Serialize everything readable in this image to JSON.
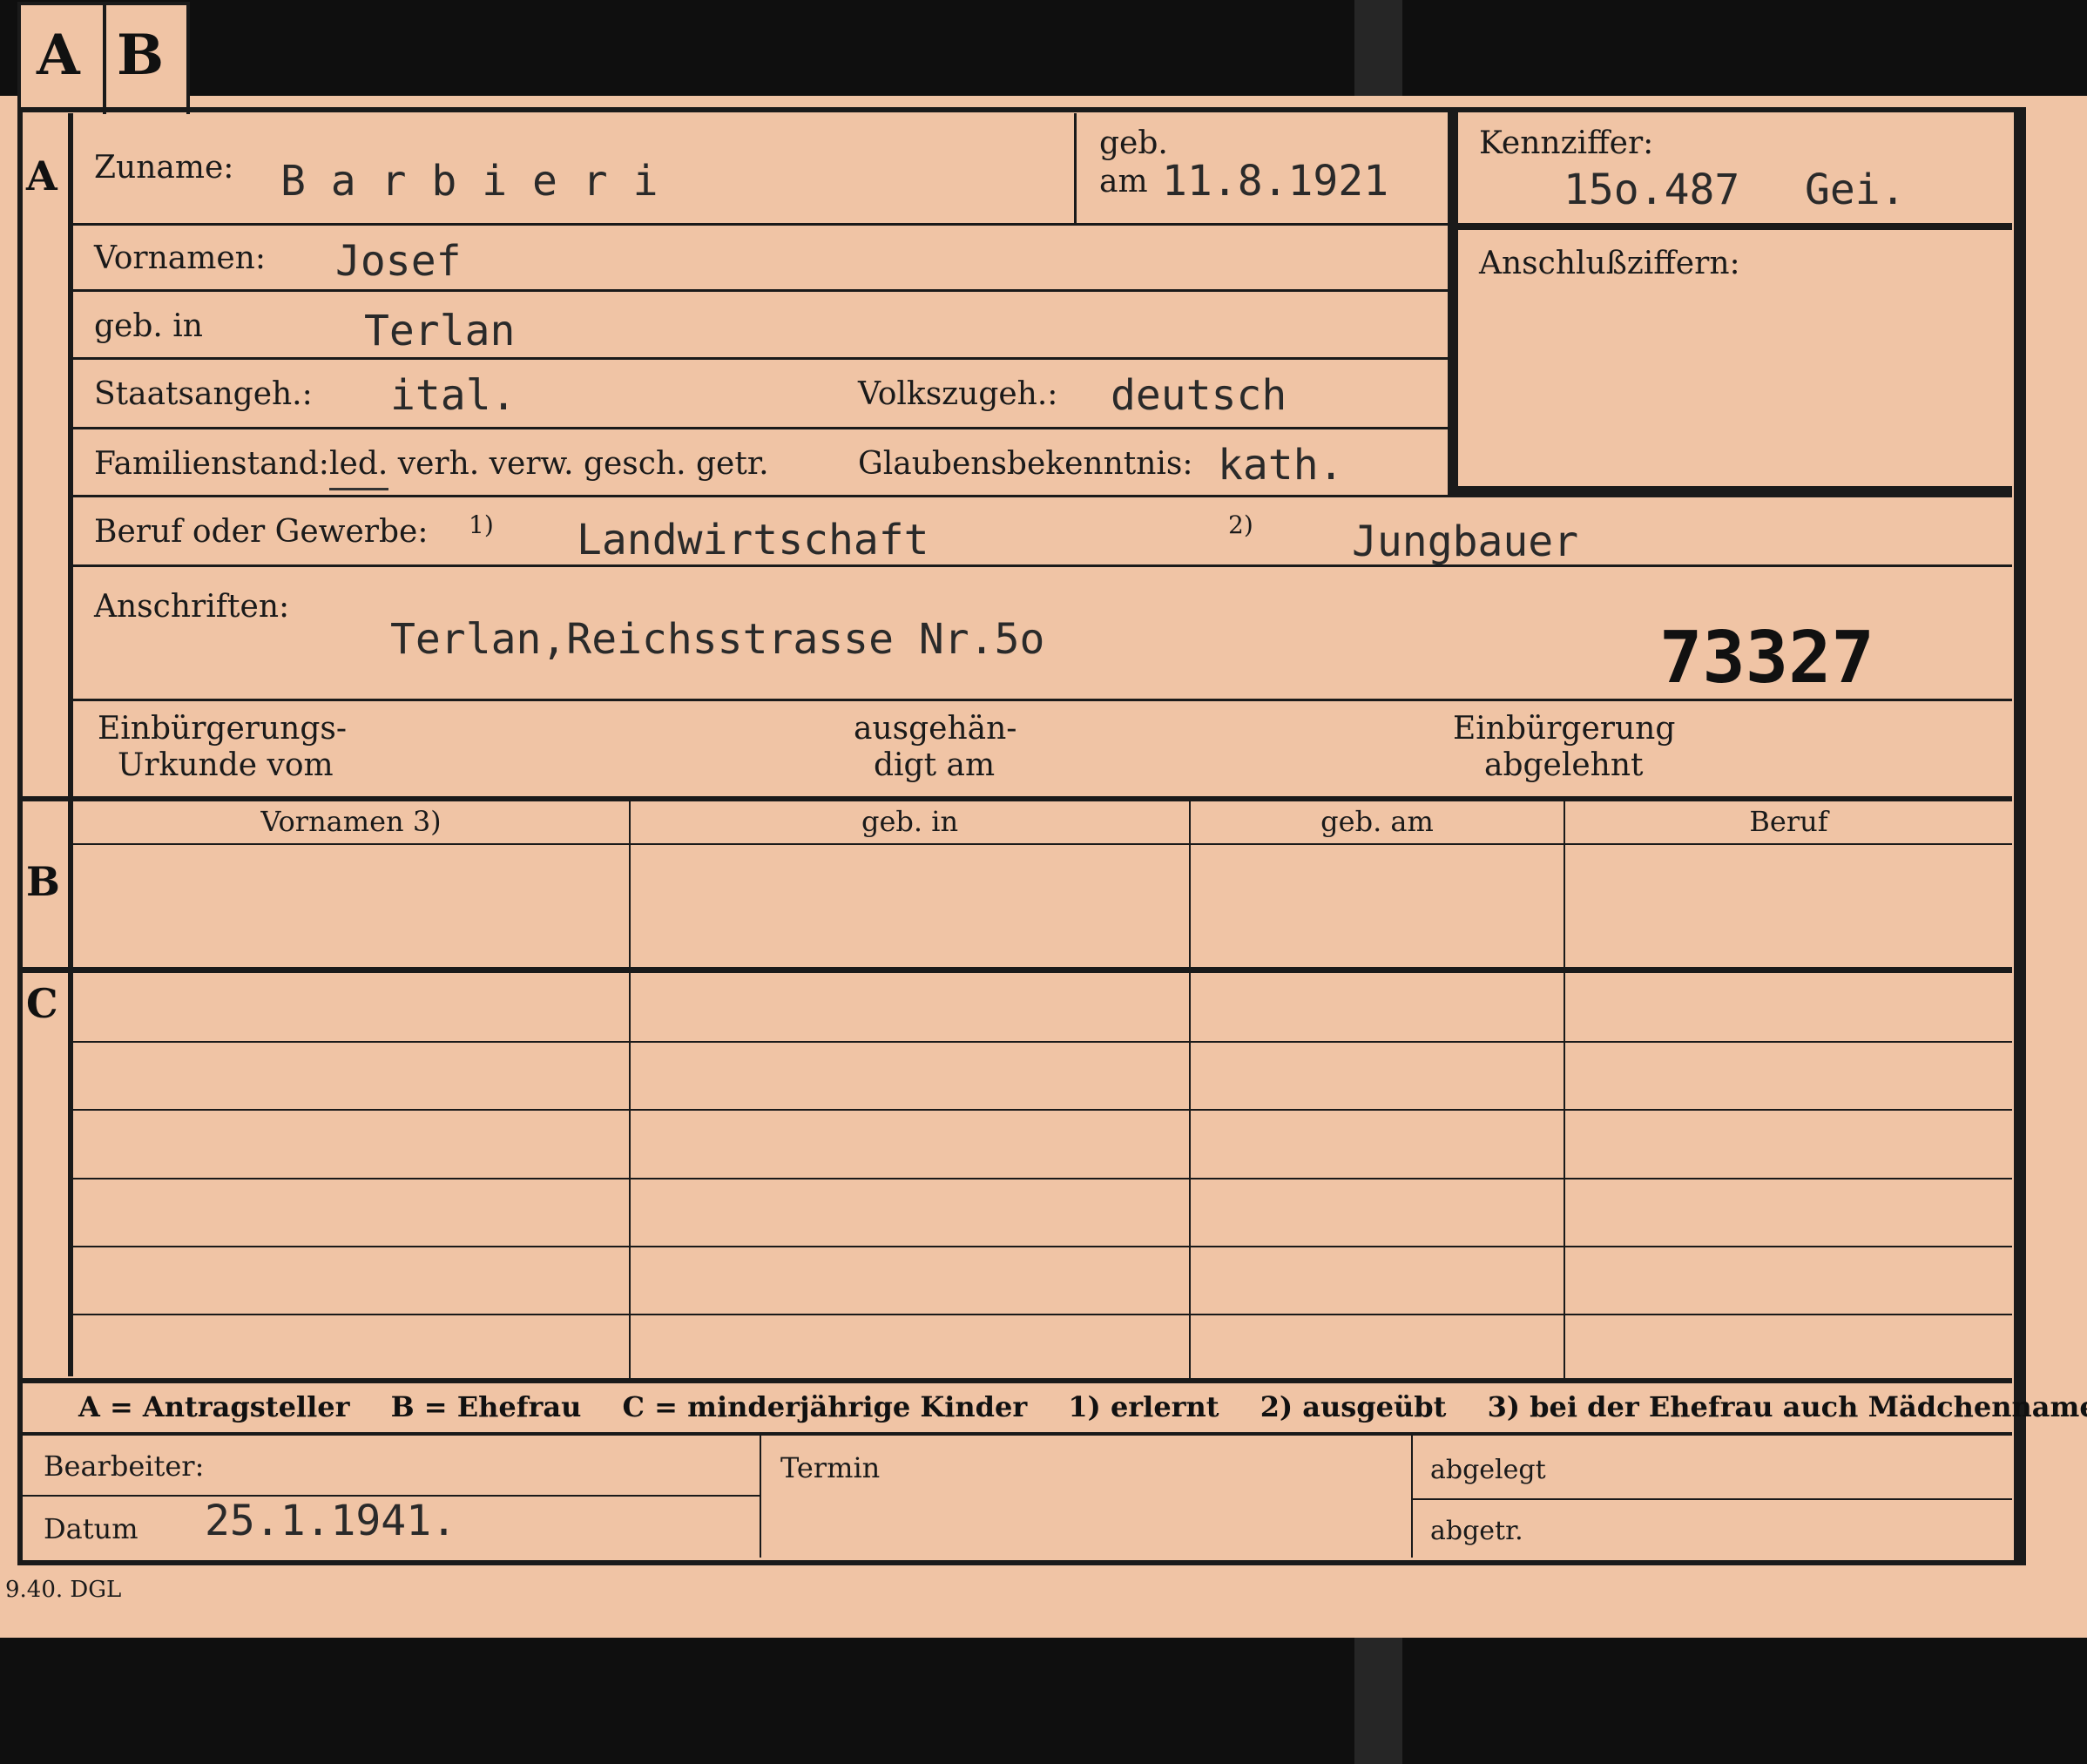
{
  "tabs": {
    "a": "A",
    "b": "B"
  },
  "sections": {
    "a": "A",
    "b": "B",
    "c": "C"
  },
  "labels": {
    "surname": "Zuname:",
    "born_on_1": "geb.",
    "born_on_2": "am",
    "id_number": "Kennziffer:",
    "connecting_numbers": "Anschlußziffern:",
    "first_names": "Vornamen:",
    "birthplace": "geb. in",
    "citizenship": "Staatsangeh.:",
    "ethnicity": "Volkszugeh.:",
    "marital_status": "Familienstand:",
    "marital_options": "led. verh. verw. gesch. getr.",
    "religion": "Glaubensbekenntnis:",
    "occupation": "Beruf oder Gewerbe:",
    "occ_note_1": "1)",
    "occ_note_2": "2)",
    "addresses": "Anschriften:",
    "naturalization_doc_1": "Einbürgerungs-",
    "naturalization_doc_2": "Urkunde vom",
    "handed_over_1": "ausgehän-",
    "handed_over_2": "digt am",
    "naturalization_rejected_1": "Einbürgerung",
    "naturalization_rejected_2": "abgelehnt",
    "editor": "Bearbeiter:",
    "date": "Datum",
    "deadline": "Termin",
    "filed": "abgelegt",
    "abget": "abgetr."
  },
  "values": {
    "surname": "B a r b i e r i",
    "born_on": "11.8.1921",
    "id_number": "15o.487",
    "id_suffix": "Gei.",
    "first_names": "Josef",
    "birthplace": "Terlan",
    "citizenship": "ital.",
    "ethnicity": "deutsch",
    "religion": "kath.",
    "occupation_1": "Landwirtschaft",
    "occupation_2": "Jungbauer",
    "address": "Terlan,Reichsstrasse Nr.5o",
    "stamp_number": "73327",
    "date": "25.1.1941."
  },
  "table": {
    "headers": [
      "Vornamen 3)",
      "geb. in",
      "geb. am",
      "Beruf"
    ]
  },
  "legend": [
    "A = Antragsteller",
    "B = Ehefrau",
    "C = minderjährige Kinder",
    "1) erlernt",
    "2) ausgeübt",
    "3) bei der Ehefrau auch Mädchenname"
  ],
  "footer": {
    "print_code": "9.40. DGL"
  },
  "colors": {
    "card": "#f0c4a5",
    "ink": "#1a1a1a",
    "background": "#0f0f0f"
  }
}
